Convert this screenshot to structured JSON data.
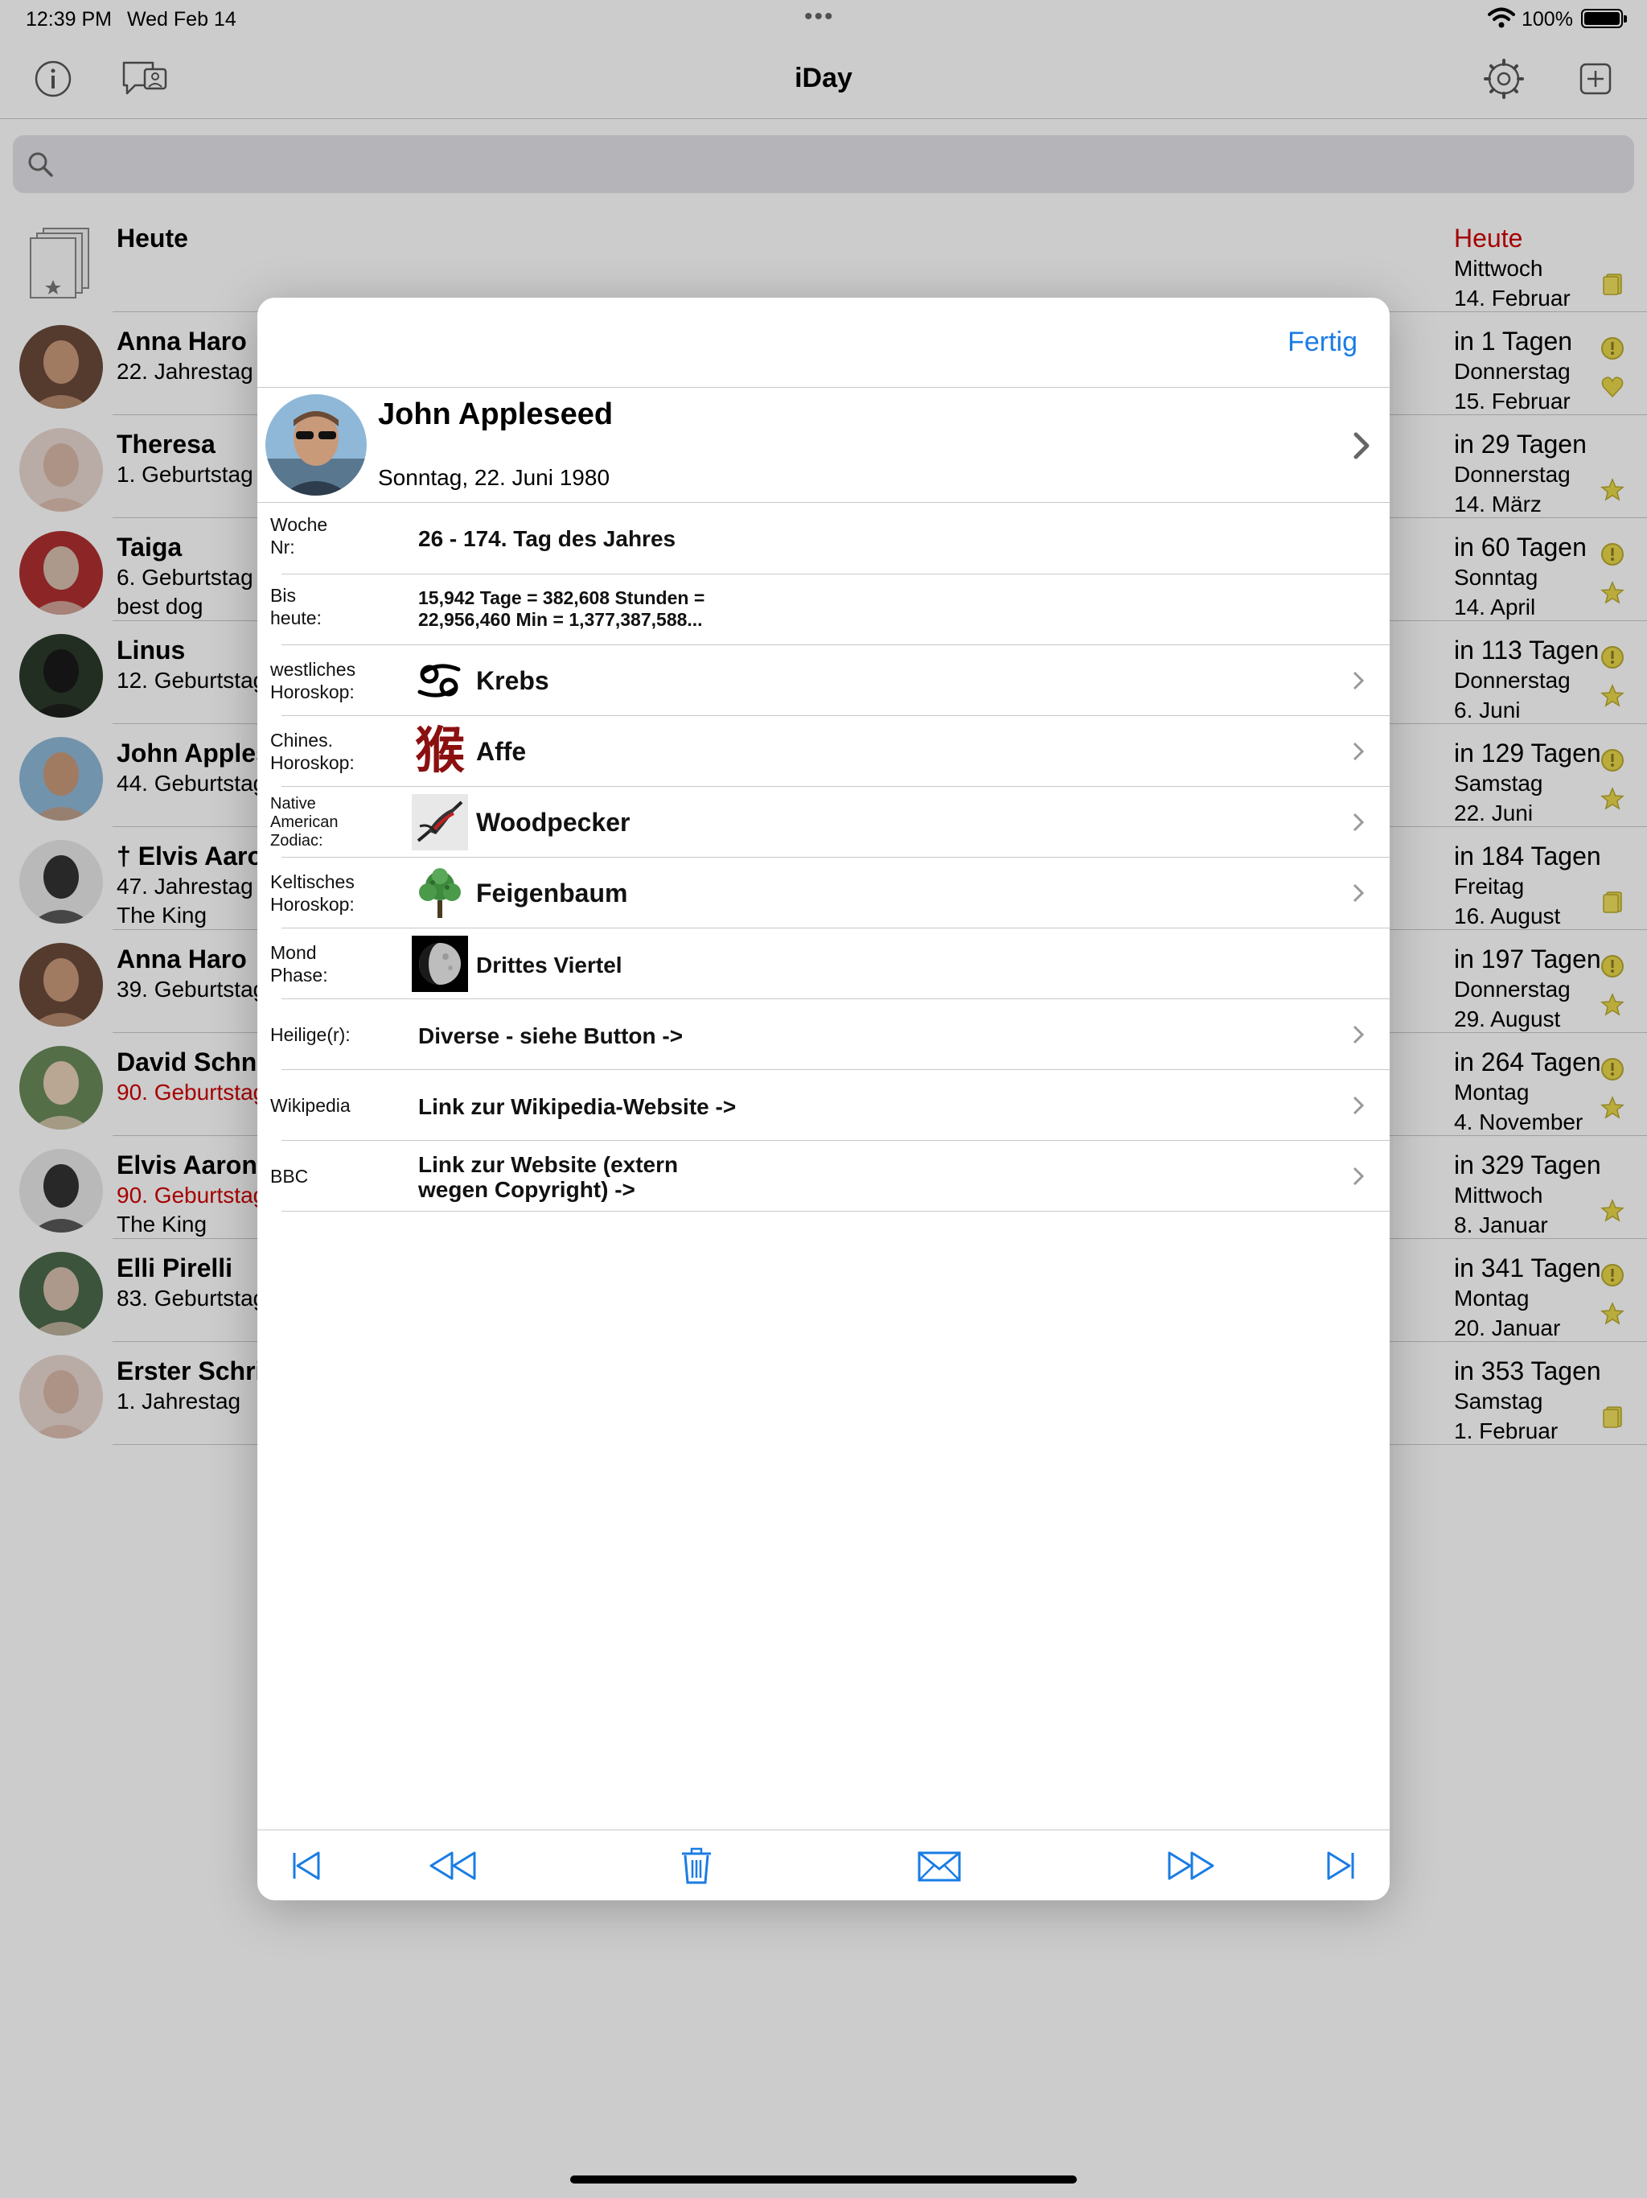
{
  "status": {
    "time": "12:39 PM",
    "date": "Wed Feb 14",
    "battery": "100%"
  },
  "nav": {
    "title": "iDay"
  },
  "search": {
    "placeholder": ""
  },
  "list": [
    {
      "name": "Heute",
      "sub": "",
      "sub_red": false,
      "note": "",
      "days": "Heute",
      "days_red": true,
      "weekday": "Mittwoch",
      "date": "14. Februar",
      "icons": [
        "calendar-icon"
      ]
    },
    {
      "name": "Anna Haro",
      "sub": "22.  Jahrestag",
      "sub_red": false,
      "note": "",
      "days": "in 1 Tagen",
      "days_red": false,
      "weekday": "Donnerstag",
      "date": "15. Februar",
      "icons": [
        "info-icon",
        "heart-icon"
      ]
    },
    {
      "name": "Theresa",
      "sub": "1.  Geburtstag",
      "sub_red": false,
      "note": "",
      "days": "in 29 Tagen",
      "days_red": false,
      "weekday": "Donnerstag",
      "date": "14. März",
      "icons": [
        "star-icon"
      ]
    },
    {
      "name": "Taiga",
      "sub": "6.  Geburtstag",
      "sub_red": false,
      "note": "best dog",
      "days": "in 60 Tagen",
      "days_red": false,
      "weekday": "Sonntag",
      "date": "14. April",
      "icons": [
        "info-icon",
        "star-icon"
      ]
    },
    {
      "name": "Linus",
      "sub": "12.  Geburtstag",
      "sub_red": false,
      "note": "",
      "days": "in 113 Tagen",
      "days_red": false,
      "weekday": "Donnerstag",
      "date": "6. Juni",
      "icons": [
        "info-icon",
        "star-icon"
      ]
    },
    {
      "name": "John Appleseed",
      "sub": "44.  Geburtstag",
      "sub_red": false,
      "note": "",
      "days": "in 129 Tagen",
      "days_red": false,
      "weekday": "Samstag",
      "date": "22. Juni",
      "icons": [
        "info-icon",
        "star-icon"
      ]
    },
    {
      "name": "† Elvis Aaron Presley",
      "sub": "47.  Jahrestag",
      "sub_red": false,
      "note": "The King",
      "days": "in 184 Tagen",
      "days_red": false,
      "weekday": "Freitag",
      "date": "16. August",
      "icons": [
        "calendar-icon"
      ]
    },
    {
      "name": "Anna Haro",
      "sub": "39.  Geburtstag",
      "sub_red": false,
      "note": "",
      "days": "in 197 Tagen",
      "days_red": false,
      "weekday": "Donnerstag",
      "date": "29. August",
      "icons": [
        "info-icon",
        "star-icon"
      ]
    },
    {
      "name": "David Schneider",
      "sub": "90.  Geburtstag",
      "sub_red": true,
      "note": "",
      "days": "in 264 Tagen",
      "days_red": false,
      "weekday": "Montag",
      "date": "4. November",
      "icons": [
        "info-icon",
        "star-icon"
      ]
    },
    {
      "name": "Elvis Aaron Presley",
      "sub": "90.  Geburtstag",
      "sub_red": true,
      "note": "The King",
      "days": "in 329 Tagen",
      "days_red": false,
      "weekday": "Mittwoch",
      "date": "8. Januar",
      "icons": [
        "star-icon"
      ]
    },
    {
      "name": "Elli Pirelli",
      "sub": "83.  Geburtstag",
      "sub_red": false,
      "note": "",
      "days": "in 341 Tagen",
      "days_red": false,
      "weekday": "Montag",
      "date": "20. Januar",
      "icons": [
        "info-icon",
        "star-icon"
      ]
    },
    {
      "name": "Erster Schritt",
      "sub": "1.  Jahrestag",
      "sub_red": false,
      "note": "",
      "days": "in 353 Tagen",
      "days_red": false,
      "weekday": "Samstag",
      "date": "1. Februar",
      "icons": [
        "calendar-icon"
      ]
    }
  ],
  "modal": {
    "done_label": "Fertig",
    "person": {
      "name": "John Appleseed",
      "date": "Sonntag, 22. Juni 1980"
    },
    "rows": {
      "week": {
        "label1": "Woche",
        "label2": "Nr:",
        "value": "26 - 174. Tag des Jahres"
      },
      "since": {
        "label1": "Bis",
        "label2": "heute:",
        "value1": "15,942 Tage = 382,608 Stunden =",
        "value2": "22,956,460 Min = 1,377,387,588..."
      },
      "western": {
        "label1": "westliches",
        "label2": "Horoskop:",
        "value": "Krebs"
      },
      "chinese": {
        "label1": "Chines.",
        "label2": "Horoskop:",
        "value": "Affe",
        "glyph": "猴"
      },
      "native": {
        "label1": "Native",
        "label2": "American",
        "label3": "Zodiac:",
        "value": "Woodpecker"
      },
      "celtic": {
        "label1": "Keltisches",
        "label2": "Horoskop:",
        "value": "Feigenbaum"
      },
      "moon": {
        "label1": "Mond",
        "label2": "Phase:",
        "value": "Drittes Viertel"
      },
      "saints": {
        "label": "Heilige(r):",
        "value": "Diverse - siehe Button ->"
      },
      "wikipedia": {
        "label": "Wikipedia",
        "value": "Link zur Wikipedia-Website ->"
      },
      "bbc": {
        "label": "BBC",
        "value1": "Link zur Website (extern",
        "value2": "wegen Copyright) ->"
      }
    },
    "toolbar": [
      "skip-to-first-icon",
      "rewind-icon",
      "trash-icon",
      "mail-icon",
      "fast-forward-icon",
      "skip-to-last-icon"
    ]
  },
  "colors": {
    "accent": "#1a7ce4",
    "red": "#d00000",
    "badge_yellow": "#e8d84a"
  }
}
